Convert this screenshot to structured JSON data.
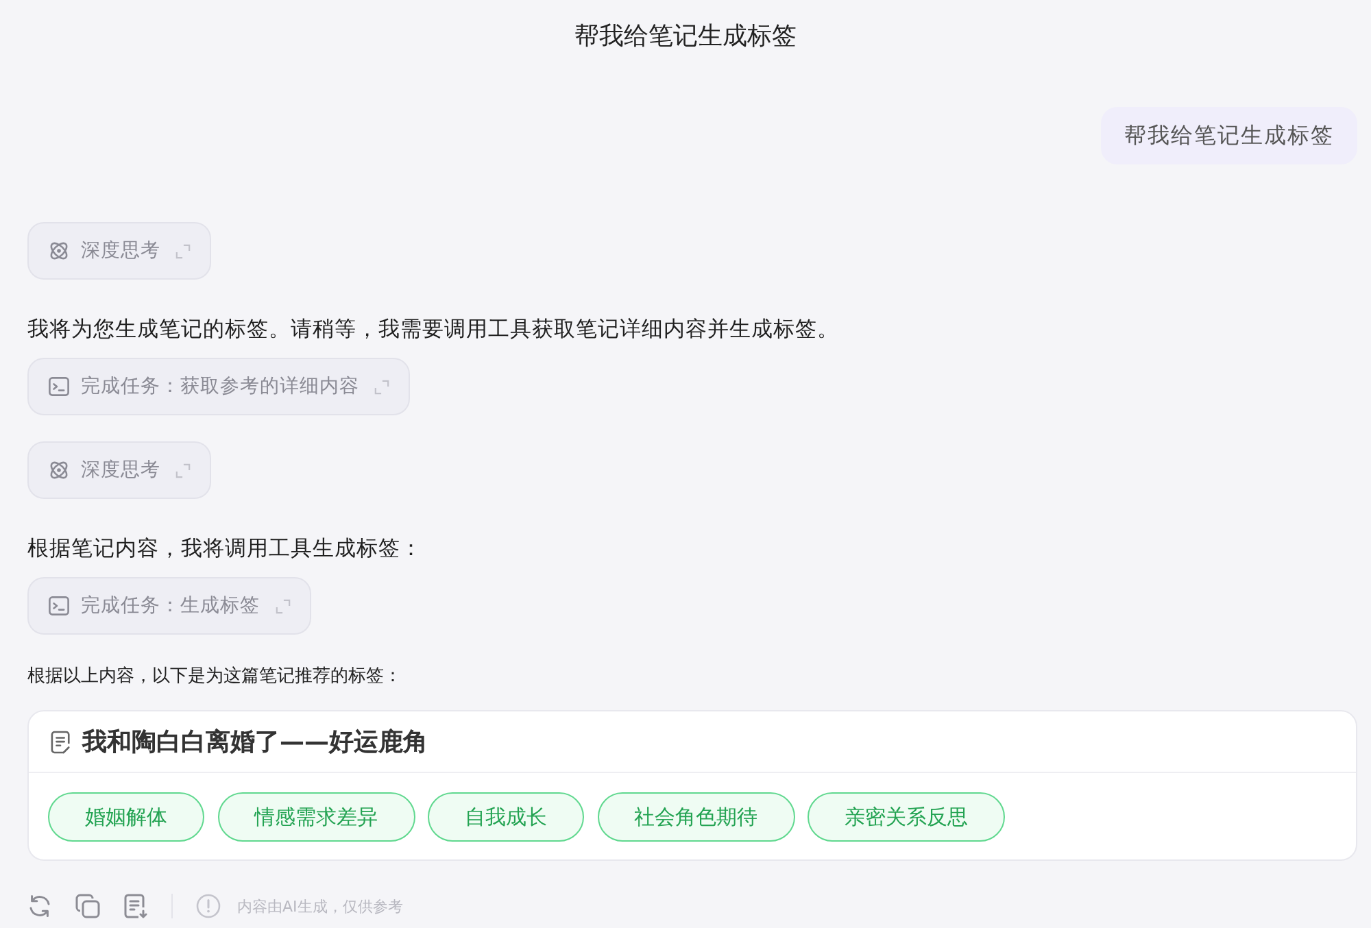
{
  "title": "帮我给笔记生成标签",
  "user_message": {
    "text": "帮我给笔记生成标签"
  },
  "steps": [
    {
      "kind": "thinking",
      "text": "深度思考"
    },
    {
      "kind": "text",
      "text": "我将为您生成笔记的标签。请稍等，我需要调用工具获取笔记详细内容并生成标签。"
    },
    {
      "kind": "task",
      "text": "完成任务：获取参考的详细内容"
    },
    {
      "kind": "thinking",
      "text": "深度思考"
    },
    {
      "kind": "text",
      "text": "根据笔记内容，我将调用工具生成标签："
    },
    {
      "kind": "task",
      "text": "完成任务：生成标签"
    },
    {
      "kind": "caption",
      "text": "根据以上内容，以下是为这篇笔记推荐的标签："
    }
  ],
  "tag_card": {
    "title": "我和陶白白离婚了——好运鹿角",
    "tags": [
      "婚姻解体",
      "情感需求差异",
      "自我成长",
      "社会角色期待",
      "亲密关系反思"
    ]
  },
  "footer": {
    "disclaimer": "内容由AI生成，仅供参考"
  }
}
